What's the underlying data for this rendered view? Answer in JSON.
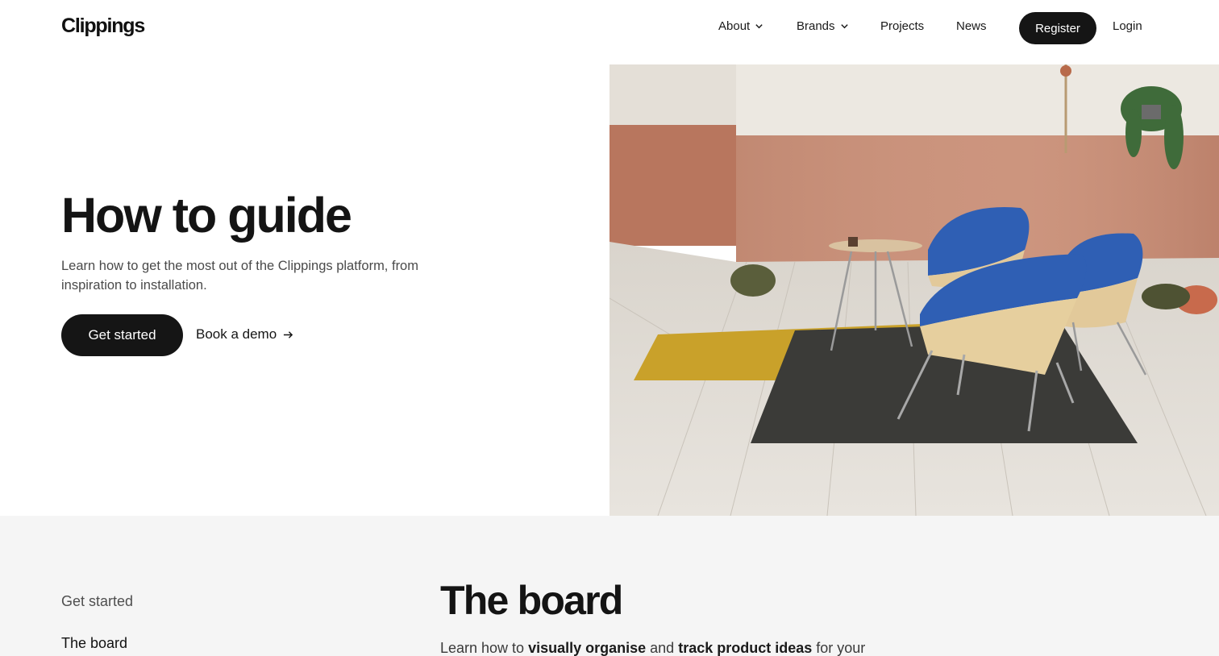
{
  "header": {
    "logo": "Clippings",
    "nav": {
      "about": "About",
      "brands": "Brands",
      "projects": "Projects",
      "news": "News"
    },
    "register": "Register",
    "login": "Login"
  },
  "hero": {
    "title": "How to guide",
    "subtitle": "Learn how to get the most out of the Clippings platform, from inspiration to installation.",
    "primary_cta": "Get started",
    "secondary_cta": "Book a demo"
  },
  "toc": {
    "items": [
      "Get started",
      "The board"
    ]
  },
  "section": {
    "title": "The board",
    "text_parts": [
      "Learn how to ",
      "visually organise",
      " and ",
      "track product ideas",
      " for your"
    ]
  },
  "colors": {
    "dark": "#151515",
    "lower_bg": "#f5f5f5",
    "wall_terracotta": "#c48a73",
    "chair_blue": "#2f5fb4",
    "rug_mustard": "#c9a12a"
  }
}
